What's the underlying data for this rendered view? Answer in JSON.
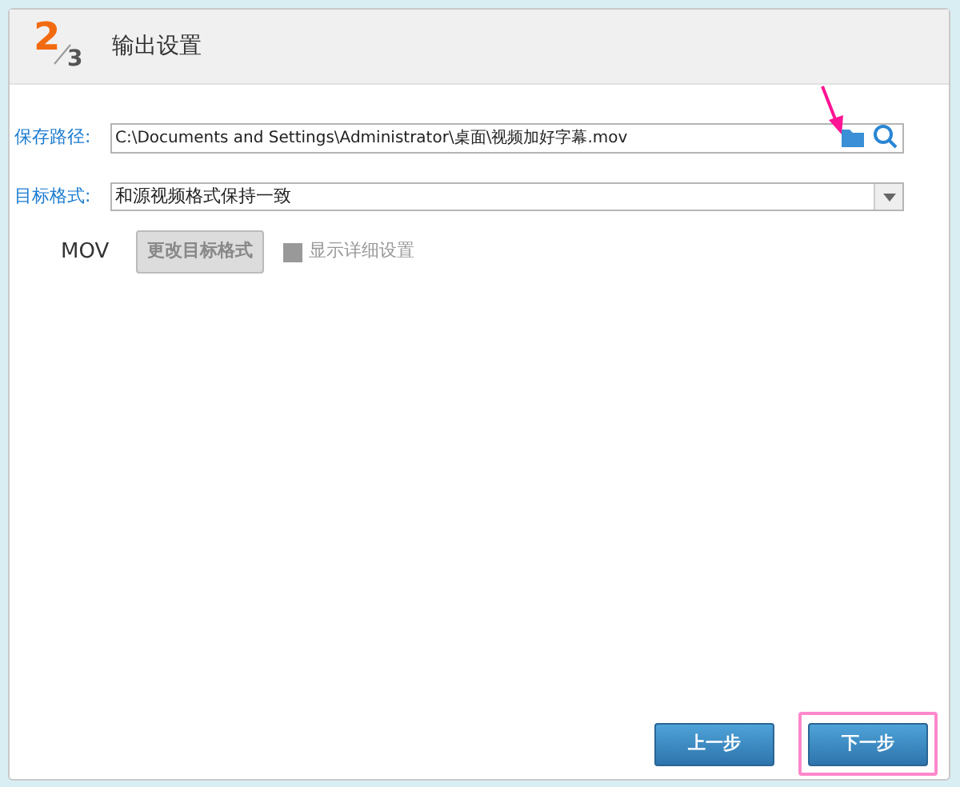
{
  "header": {
    "step": "2",
    "total": "3",
    "title": "输出设置"
  },
  "save_path": {
    "label": "保存路径:",
    "value": "C:\\Documents and Settings\\Administrator\\桌面\\视频加好字幕.mov"
  },
  "target_format": {
    "label": "目标格式:",
    "value": "和源视频格式保持一致"
  },
  "format_name": "MOV",
  "change_format_button": {
    "label": "更改目标格式",
    "disabled": true
  },
  "show_details": {
    "label": "显示详细设置",
    "checked": false,
    "disabled": true
  },
  "buttons": [
    {
      "label": "上一步",
      "highlighted": false
    },
    {
      "label": "下一步",
      "highlighted": true
    }
  ]
}
